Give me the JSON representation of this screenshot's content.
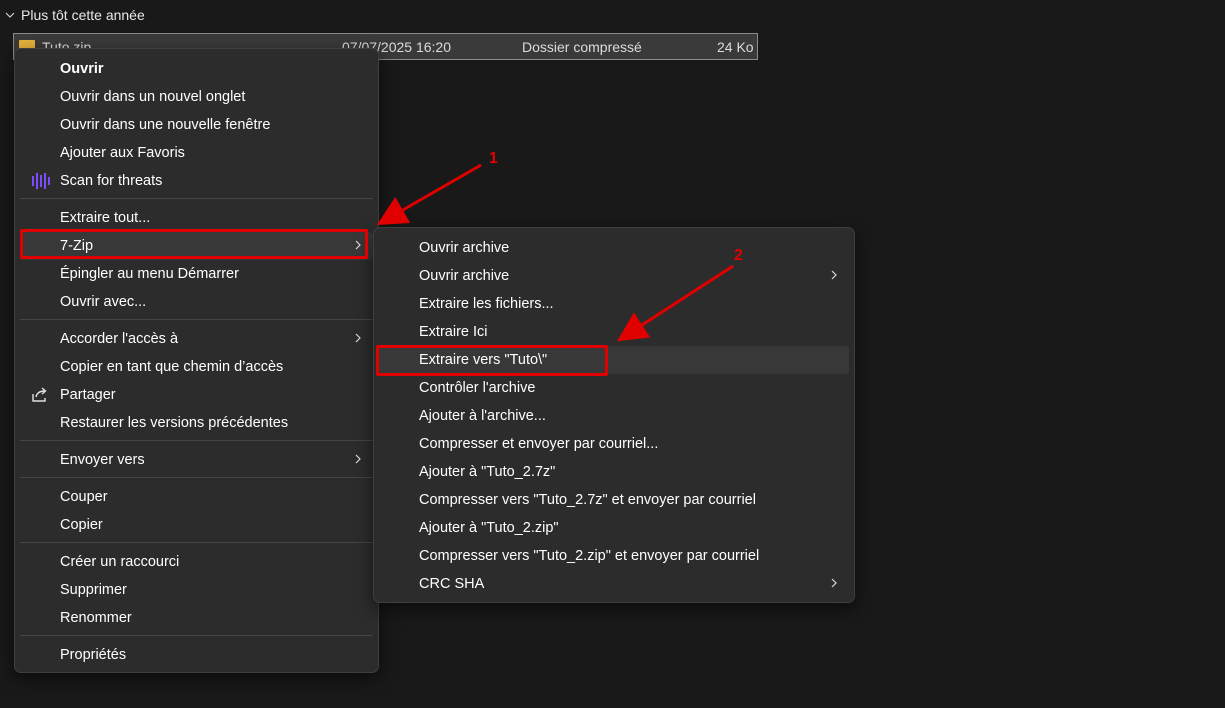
{
  "explorer": {
    "group_label": "Plus tôt cette année",
    "file": {
      "name": "Tuto.zip",
      "date": "07/07/2025 16:20",
      "type": "Dossier compressé",
      "size": "24 Ko"
    }
  },
  "context_menu": {
    "items": [
      {
        "label": "Ouvrir"
      },
      {
        "label": "Ouvrir dans un nouvel onglet"
      },
      {
        "label": "Ouvrir dans une nouvelle fenêtre"
      },
      {
        "label": "Ajouter aux Favoris"
      },
      {
        "label": "Scan for threats"
      },
      {
        "label": "Extraire tout..."
      },
      {
        "label": "7-Zip"
      },
      {
        "label": "Épingler au menu Démarrer"
      },
      {
        "label": "Ouvrir avec..."
      },
      {
        "label": "Accorder l'accès à"
      },
      {
        "label": "Copier en tant que chemin d’accès"
      },
      {
        "label": "Partager"
      },
      {
        "label": "Restaurer les versions précédentes"
      },
      {
        "label": "Envoyer vers"
      },
      {
        "label": "Couper"
      },
      {
        "label": "Copier"
      },
      {
        "label": "Créer un raccourci"
      },
      {
        "label": "Supprimer"
      },
      {
        "label": "Renommer"
      },
      {
        "label": "Propriétés"
      }
    ]
  },
  "submenu_7zip": {
    "items": [
      {
        "label": "Ouvrir archive"
      },
      {
        "label": "Ouvrir archive"
      },
      {
        "label": "Extraire les fichiers..."
      },
      {
        "label": "Extraire Ici"
      },
      {
        "label": "Extraire vers \"Tuto\\\""
      },
      {
        "label": "Contrôler l'archive"
      },
      {
        "label": "Ajouter à l'archive..."
      },
      {
        "label": "Compresser et envoyer par courriel..."
      },
      {
        "label": "Ajouter à \"Tuto_2.7z\""
      },
      {
        "label": "Compresser vers \"Tuto_2.7z\" et envoyer par courriel"
      },
      {
        "label": "Ajouter à \"Tuto_2.zip\""
      },
      {
        "label": "Compresser vers \"Tuto_2.zip\" et envoyer par courriel"
      },
      {
        "label": "CRC SHA"
      }
    ]
  },
  "annotations": {
    "step1": "1",
    "step2": "2",
    "color": "#e00000"
  },
  "icons": {
    "group_chevron": "chevron-down-icon",
    "file": "zip-folder-icon",
    "scan": "antivirus-scan-icon",
    "share": "share-icon",
    "submenu_arrow": "chevron-right-icon"
  }
}
